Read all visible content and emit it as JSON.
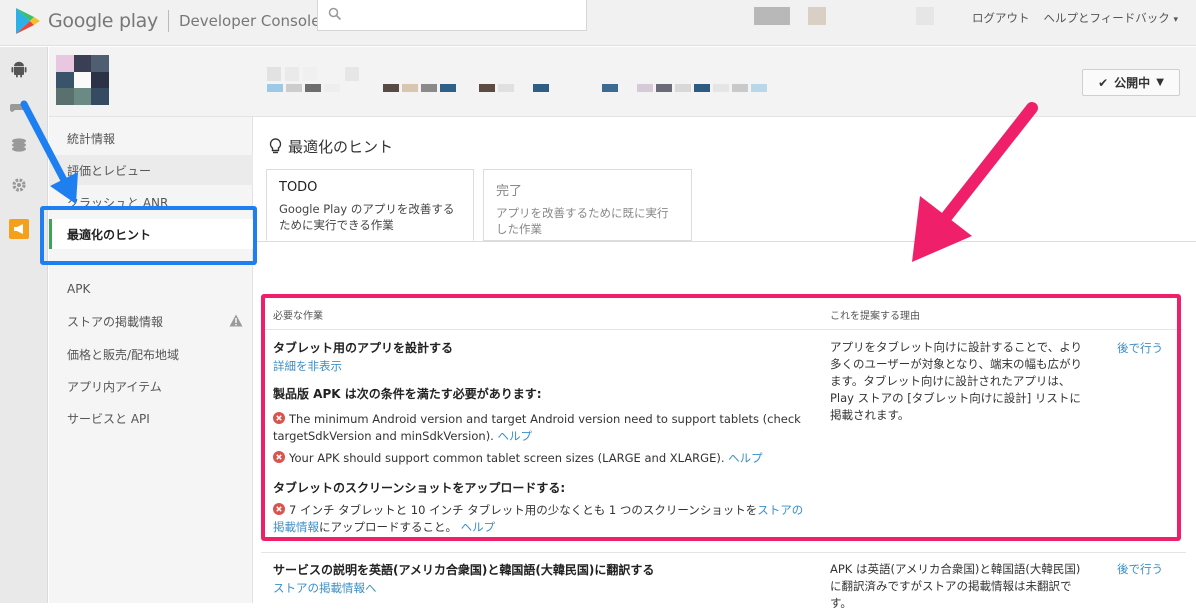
{
  "header": {
    "brand_name": "Google play",
    "console_title": "Developer Console",
    "search_placeholder": "",
    "logout": "ログアウト",
    "help_feedback": "ヘルプとフィードバック"
  },
  "app": {
    "publish_status": "公開中"
  },
  "sidebar": {
    "items": [
      {
        "label": "統計情報"
      },
      {
        "label": "評価とレビュー"
      },
      {
        "label": "クラッシュと ANR"
      },
      {
        "label": "最適化のヒント"
      },
      {
        "label": "APK"
      },
      {
        "label": "ストアの掲載情報"
      },
      {
        "label": "価格と販売/配布地域"
      },
      {
        "label": "アプリ内アイテム"
      },
      {
        "label": "サービスと API"
      }
    ]
  },
  "main": {
    "title": "最適化のヒント",
    "tabs": [
      {
        "label": "TODO",
        "description": "Google Play のアプリを改善するために実行できる作業"
      },
      {
        "label": "完了",
        "description": "アプリを改善するために既に実行した作業"
      }
    ],
    "columns": {
      "task": "必要な作業",
      "reason": "これを提案する理由"
    },
    "tasks": [
      {
        "title": "タブレット用のアプリを設計する",
        "toggle_link": "詳細を非表示",
        "section1_title": "製品版 APK は次の条件を満たす必要があります:",
        "req1": "The minimum Android version and target Android version need to support tablets (check targetSdkVersion and minSdkVersion).",
        "req2": "Your APK should support common tablet screen sizes (LARGE and XLARGE).",
        "help": "ヘルプ",
        "section2_title": "タブレットのスクリーンショットをアップロードする:",
        "req3_pre": "7 インチ タブレットと 10 インチ タブレット用の少なくとも 1 つのスクリーンショットを",
        "req3_link": "ストアの掲載情報",
        "req3_post": "にアップロードすること。",
        "reason": "アプリをタブレット向けに設計することで、より多くのユーザーが対象となり、端末の幅も広がります。タブレット向けに設計されたアプリは、Play ストアの [タブレット向けに設計] リストに掲載されます。",
        "later": "後で行う"
      },
      {
        "title": "サービスの説明を英語(アメリカ合衆国)と韓国語(大韓民国)に翻訳する",
        "link": "ストアの掲載情報へ",
        "reason": "APK は英語(アメリカ合衆国)と韓国語(大韓民国)に翻訳済みですがストアの掲載情報は未翻訳です。",
        "later": "後で行う"
      }
    ]
  },
  "colors": {
    "annotation_blue": "#1e7ff0",
    "annotation_pink": "#ef1f6a",
    "link": "#3a8fc7",
    "active_marker": "#3aa757"
  }
}
